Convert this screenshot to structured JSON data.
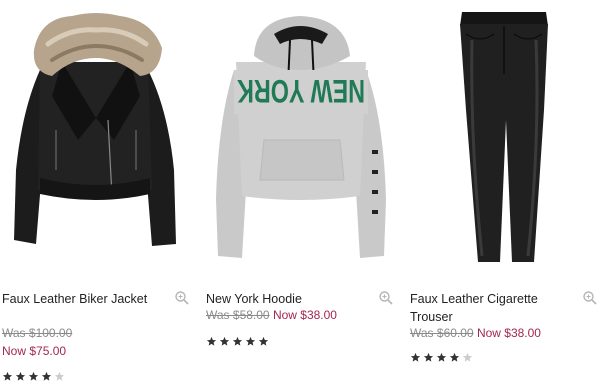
{
  "products": [
    {
      "name": "Faux Leather Biker Jacket",
      "was_price": "Was $100.00",
      "now_price": "Now $75.00",
      "rating": 4,
      "rating_max": 5,
      "image_icon": "biker-jacket-image"
    },
    {
      "name": "New York Hoodie",
      "was_price": "Was $58.00",
      "now_price": "Now $38.00",
      "rating": 5,
      "rating_max": 5,
      "image_icon": "hoodie-image",
      "print_text": "NEW YORK"
    },
    {
      "name": "Faux Leather Cigarette Trouser",
      "was_price": "Was $60.00",
      "now_price": "Now $38.00",
      "rating": 4,
      "rating_max": 5,
      "image_icon": "trouser-image"
    }
  ],
  "colors": {
    "sale": "#a3284f",
    "was": "#8a8a8a",
    "star_filled": "#333333",
    "star_empty": "#cccccc",
    "print_green": "#1f7a55"
  },
  "icons": {
    "zoom": "magnifier-icon",
    "star": "star-icon"
  }
}
